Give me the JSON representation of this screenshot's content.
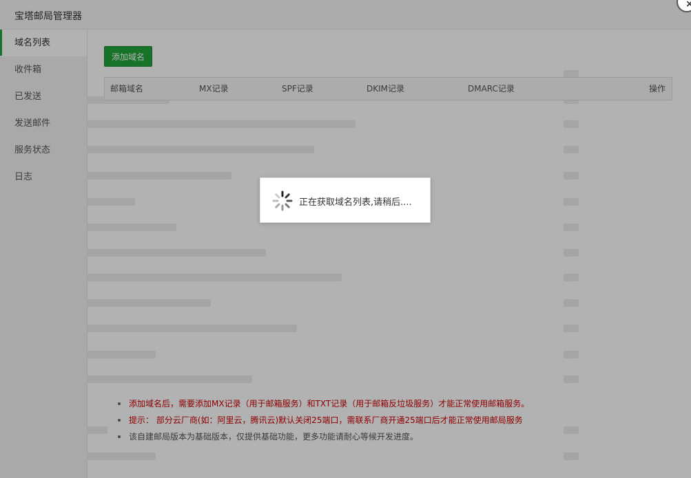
{
  "dialog": {
    "title": "宝塔邮局管理器",
    "close_symbol": "×"
  },
  "sidebar": {
    "items": [
      {
        "label": "域名列表",
        "active": true
      },
      {
        "label": "收件箱",
        "active": false
      },
      {
        "label": "已发送",
        "active": false
      },
      {
        "label": "发送邮件",
        "active": false
      },
      {
        "label": "服务状态",
        "active": false
      },
      {
        "label": "日志",
        "active": false
      }
    ]
  },
  "main": {
    "add_button": "添加域名",
    "columns": [
      "邮箱域名",
      "MX记录",
      "SPF记录",
      "DKIM记录",
      "DMARC记录",
      "操作"
    ],
    "tips": [
      "添加域名后，需要添加MX记录（用于邮箱服务）和TXT记录（用于邮箱反垃圾服务）才能正常使用邮箱服务。",
      "提示： 部分云厂商(如：阿里云，腾讯云)默认关闭25端口，需联系厂商开通25端口后才能正常使用邮局服务",
      "该自建邮局版本为基础版本，仅提供基础功能，更多功能请耐心等候开发进度。"
    ]
  },
  "loading": {
    "text": "正在获取域名列表,请稍后...."
  },
  "colors": {
    "accent": "#20a53a",
    "tip_red": "#cc0000",
    "overlay": "rgba(0,0,0,0.30)"
  },
  "icons": {
    "close": "close-icon",
    "spinner": "loading-spinner-icon"
  }
}
